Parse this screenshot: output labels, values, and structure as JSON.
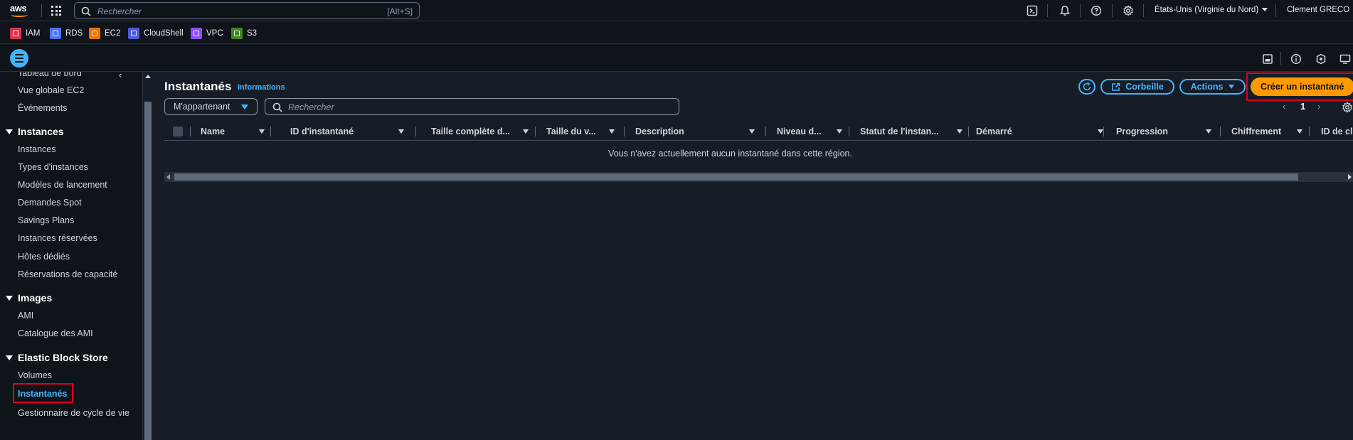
{
  "topnav": {
    "logo_text": "aws",
    "search_placeholder": "Rechercher",
    "search_shortcut": "[Alt+S]",
    "region": "États-Unis (Virginie du Nord)",
    "user": "Clement GRECO"
  },
  "favorites": [
    {
      "label": "IAM",
      "color": "#dd344c"
    },
    {
      "label": "RDS",
      "color": "#4d72f3"
    },
    {
      "label": "EC2",
      "color": "#ed7100"
    },
    {
      "label": "CloudShell",
      "color": "#4d5bd9"
    },
    {
      "label": "VPC",
      "color": "#8c4fff"
    },
    {
      "label": "S3",
      "color": "#3f8624"
    }
  ],
  "sidebar": {
    "top_partial": "Tableau de bord",
    "items_top": [
      "Vue globale EC2",
      "Événements"
    ],
    "sections": [
      {
        "title": "Instances",
        "items": [
          "Instances",
          "Types d'instances",
          "Modèles de lancement",
          "Demandes Spot",
          "Savings Plans",
          "Instances réservées",
          "Hôtes dédiés",
          "Réservations de capacité"
        ]
      },
      {
        "title": "Images",
        "items": [
          "AMI",
          "Catalogue des AMI"
        ]
      },
      {
        "title": "Elastic Block Store",
        "items": [
          "Volumes",
          "Instantanés",
          "Gestionnaire de cycle de vie"
        ]
      }
    ],
    "active_item": "Instantanés"
  },
  "main": {
    "title": "Instantanés",
    "info_link": "Informations",
    "buttons": {
      "recycle_bin": "Corbeille",
      "actions": "Actions",
      "create": "Créer un instantané"
    },
    "filter": {
      "owner_select": "M'appartenant",
      "search_placeholder": "Rechercher"
    },
    "pagination": {
      "current_page": "1"
    },
    "table": {
      "columns": [
        "Name",
        "ID d'instantané",
        "Taille complète d...",
        "Taille du v...",
        "Description",
        "Niveau d...",
        "Statut de l'instan...",
        "Démarré",
        "Progression",
        "Chiffrement",
        "ID de cl"
      ],
      "empty_message": "Vous n'avez actuellement aucun instantané dans cette région."
    }
  },
  "colors": {
    "accent": "#42b4ff",
    "primary_button": "#ff9900",
    "highlight_box": "#e0001b",
    "background": "#161d26",
    "nav_background": "#0f141a"
  }
}
